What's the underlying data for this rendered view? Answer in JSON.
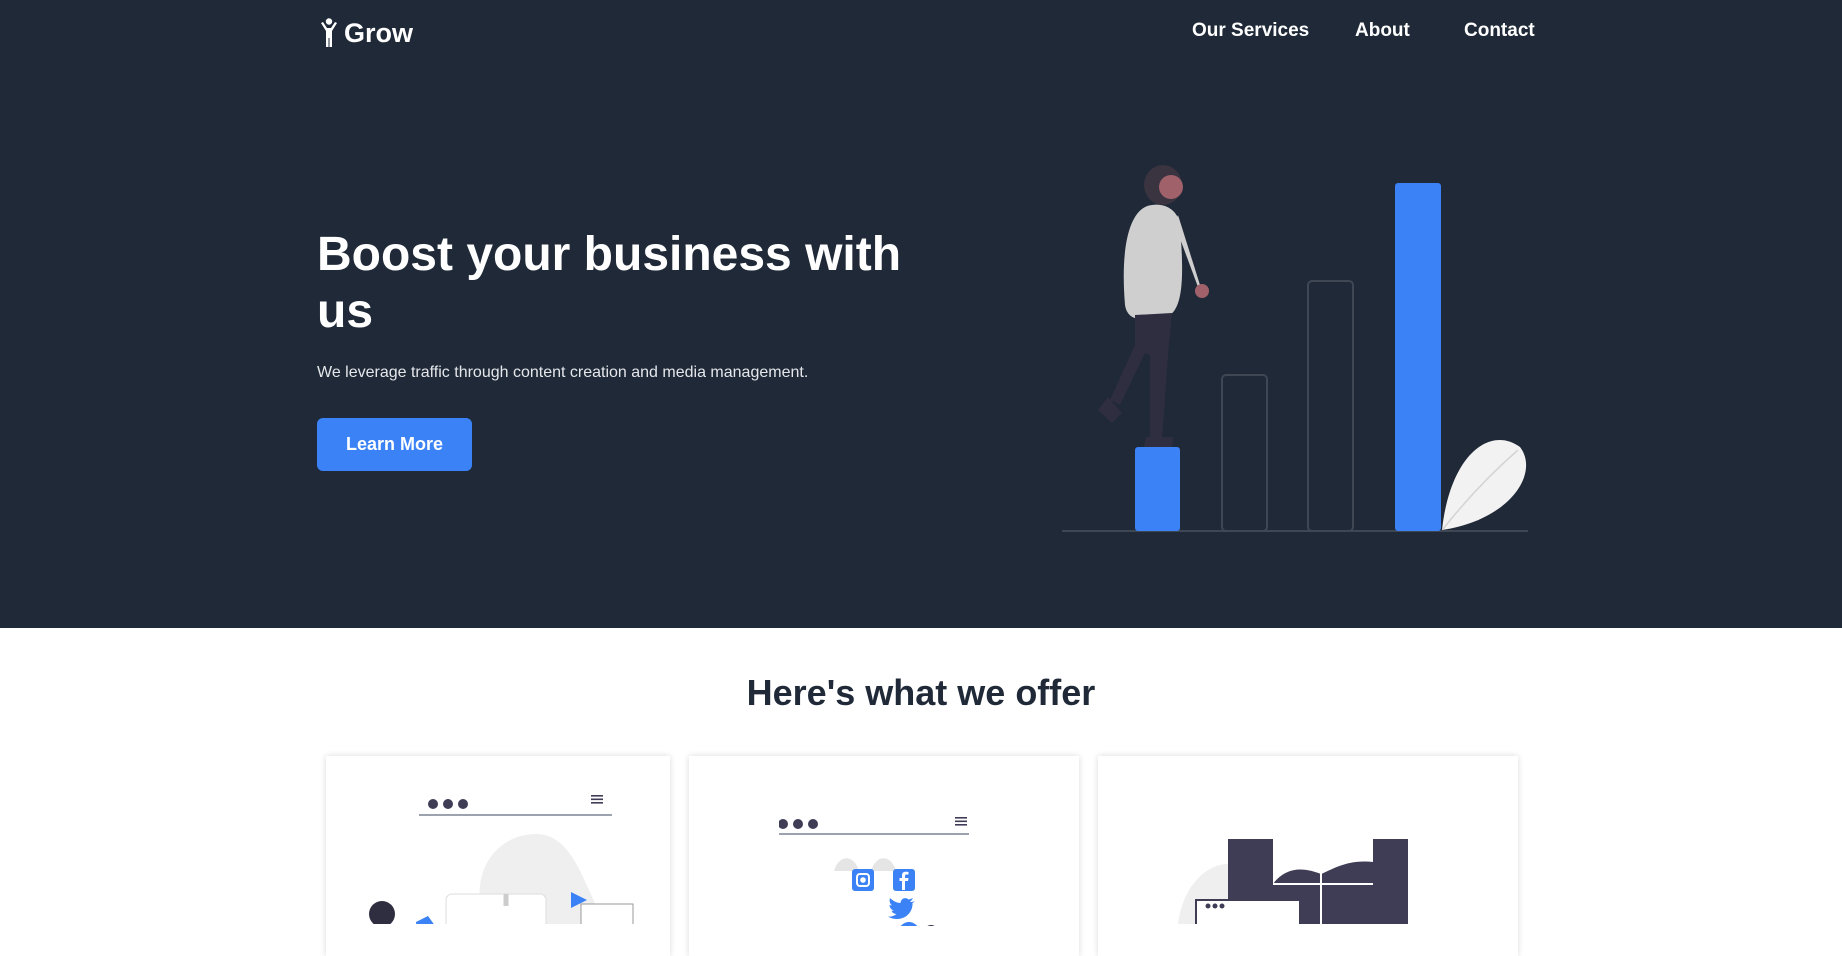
{
  "nav": {
    "brand": "Grow",
    "links": [
      "Our Services",
      "About",
      "Contact"
    ]
  },
  "hero": {
    "title": "Boost your business with us",
    "subtitle": "We leverage traffic through content creation and media management.",
    "cta_label": "Learn More"
  },
  "offer": {
    "title": "Here's what we offer"
  },
  "icons": [
    "person-logo-icon",
    "play-icon",
    "instagram-icon",
    "facebook-icon",
    "twitter-icon",
    "menu-icon"
  ],
  "colors": {
    "hero_bg": "#1f2937",
    "accent": "#3b82f6",
    "text_dark": "#1f2937"
  }
}
